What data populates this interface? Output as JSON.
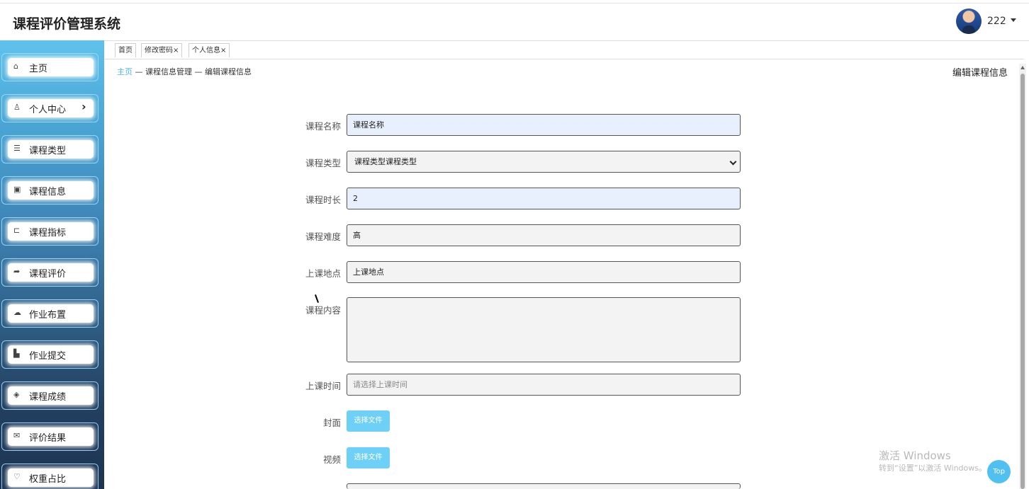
{
  "header": {
    "title": "课程评价管理系统",
    "username": "222"
  },
  "sidebar": {
    "items": [
      {
        "label": "主页",
        "icon": "⌂"
      },
      {
        "label": "个人中心",
        "icon": "♙",
        "chevron": "›"
      },
      {
        "label": "课程类型",
        "icon": "☰"
      },
      {
        "label": "课程信息",
        "icon": "▣"
      },
      {
        "label": "课程指标",
        "icon": "⊏"
      },
      {
        "label": "课程评价",
        "icon": "➦"
      },
      {
        "label": "作业布置",
        "icon": "☁"
      },
      {
        "label": "作业提交",
        "icon": "▙"
      },
      {
        "label": "课程成绩",
        "icon": "◈"
      },
      {
        "label": "评价结果",
        "icon": "✉"
      },
      {
        "label": "权重占比",
        "icon": "♡"
      }
    ]
  },
  "tabs": [
    {
      "label": "首页"
    },
    {
      "label": "修改密码",
      "close": "×"
    },
    {
      "label": "个人信息",
      "close": "×"
    }
  ],
  "breadcrumb": {
    "home": "主页",
    "sep": " — ",
    "level2": "课程信息管理",
    "level3": "编辑课程信息"
  },
  "page_title": "编辑课程信息",
  "form": {
    "course_name": {
      "label": "课程名称",
      "value": "课程名称"
    },
    "course_type": {
      "label": "课程类型",
      "value": "课程类型课程类型"
    },
    "duration": {
      "label": "课程时长",
      "value": "2"
    },
    "difficulty": {
      "label": "课程难度",
      "value": "高"
    },
    "location": {
      "label": "上课地点",
      "value": "上课地点"
    },
    "content": {
      "label": "课程内容",
      "value": ""
    },
    "time": {
      "label": "上课时间",
      "placeholder": "请选择上课时间"
    },
    "cover": {
      "label": "封面",
      "button": "选择文件"
    },
    "video": {
      "label": "视频",
      "button": "选择文件"
    }
  },
  "watermark": {
    "line1": "激活 Windows",
    "line2": "转到“设置”以激活 Windows。"
  },
  "top_button": "Top"
}
